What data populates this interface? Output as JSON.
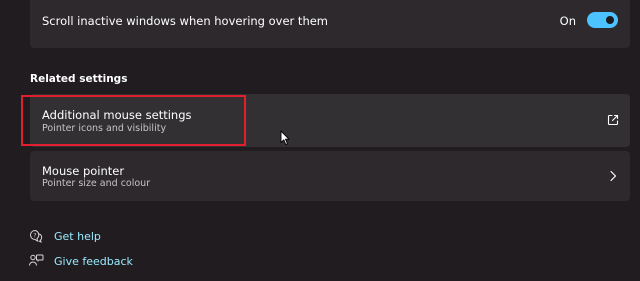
{
  "scroll_setting": {
    "label": "Scroll inactive windows when hovering over them",
    "state_label": "On",
    "enabled": true
  },
  "related_settings": {
    "heading": "Related settings",
    "items": [
      {
        "title": "Additional mouse settings",
        "description": "Pointer icons and visibility",
        "icon": "open-external-icon"
      },
      {
        "title": "Mouse pointer",
        "description": "Pointer size and colour",
        "icon": "chevron-right-icon"
      }
    ]
  },
  "links": {
    "help": {
      "label": "Get help",
      "icon": "help-chat-icon"
    },
    "feedback": {
      "label": "Give feedback",
      "icon": "feedback-icon"
    }
  },
  "colors": {
    "background": "#201c20",
    "card": "#2d292c",
    "accent": "#4cc2ff",
    "link": "#99ebff",
    "highlight": "#e0202e"
  }
}
